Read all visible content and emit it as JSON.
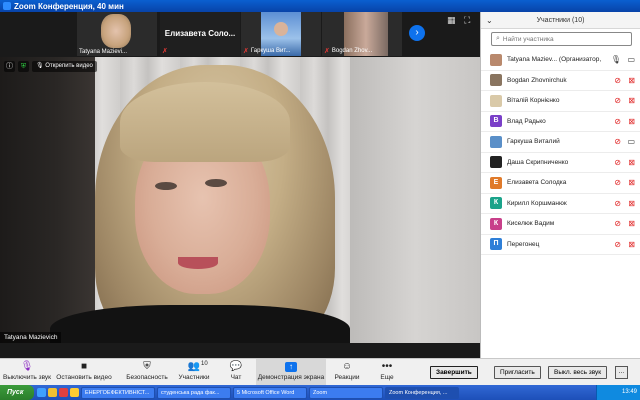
{
  "window": {
    "title": "Zoom Конференция, 40 мин"
  },
  "strip": {
    "thumbnails": [
      {
        "name": "Tatyana Mazievi..."
      },
      {
        "name": "Елизавета Соло..."
      },
      {
        "name": "Гаркуша Вит..."
      },
      {
        "name": "Bogdan Zhov..."
      }
    ],
    "next_icon": "chevron-right-icon",
    "grid_icon": "grid-view-icon",
    "fullscreen_icon": "fullscreen-icon"
  },
  "main_video": {
    "speaker_name": "Tatyana Mazievich",
    "unpin_label": "Открепить видео"
  },
  "toolbar": {
    "mute_label": "Выключить звук",
    "stop_video_label": "Остановить видео",
    "security_label": "Безопасность",
    "participants_label": "Участники",
    "participants_count": "10",
    "chat_label": "Чат",
    "share_label": "Демонстрация экрана",
    "reactions_label": "Реакции",
    "more_label": "Еще",
    "end_label": "Завершить",
    "invite_label": "Пригласить",
    "mute_all_label": "Выкл. весь звук",
    "more_small_label": "..."
  },
  "panel": {
    "title": "Участники (10)",
    "search_placeholder": "Найти участника",
    "participants": [
      {
        "name": "Tatyana Maziev... (Организатор, я)",
        "avatar_letter": "",
        "avatar_color": "#b9896d",
        "mic_muted": false,
        "cam_off": false
      },
      {
        "name": "Bogdan Zhovnirchuk",
        "avatar_letter": "",
        "avatar_color": "#8a7560",
        "mic_muted": true,
        "cam_off": true
      },
      {
        "name": "Віталій Корнієнко",
        "avatar_letter": "",
        "avatar_color": "#d9c9a8",
        "mic_muted": true,
        "cam_off": true
      },
      {
        "name": "Влад Радько",
        "avatar_letter": "В",
        "avatar_color": "#7a3fc8",
        "mic_muted": true,
        "cam_off": true
      },
      {
        "name": "Гаркуша Виталий",
        "avatar_letter": "",
        "avatar_color": "#5a8fc8",
        "mic_muted": true,
        "cam_off": false
      },
      {
        "name": "Даша Скрипниченко",
        "avatar_letter": "",
        "avatar_color": "#222222",
        "mic_muted": true,
        "cam_off": true
      },
      {
        "name": "Елизавета Солодка",
        "avatar_letter": "Е",
        "avatar_color": "#e07a2a",
        "mic_muted": true,
        "cam_off": true
      },
      {
        "name": "Кирилл Коршманюк",
        "avatar_letter": "К",
        "avatar_color": "#1aa38a",
        "mic_muted": true,
        "cam_off": true
      },
      {
        "name": "Киселюк Вадим",
        "avatar_letter": "К",
        "avatar_color": "#c83f8a",
        "mic_muted": true,
        "cam_off": true
      },
      {
        "name": "Перегонец",
        "avatar_letter": "П",
        "avatar_color": "#2f7fd8",
        "mic_muted": true,
        "cam_off": true
      }
    ]
  },
  "taskbar": {
    "start_label": "Пуск",
    "tasks": [
      "ЕНЕРГОЕФЕКТИВНІСТ...",
      "студенська рада фак...",
      "5 Microsoft Office Word",
      "Zoom",
      "Zoom Конференция, ..."
    ],
    "clock": "13:49"
  }
}
